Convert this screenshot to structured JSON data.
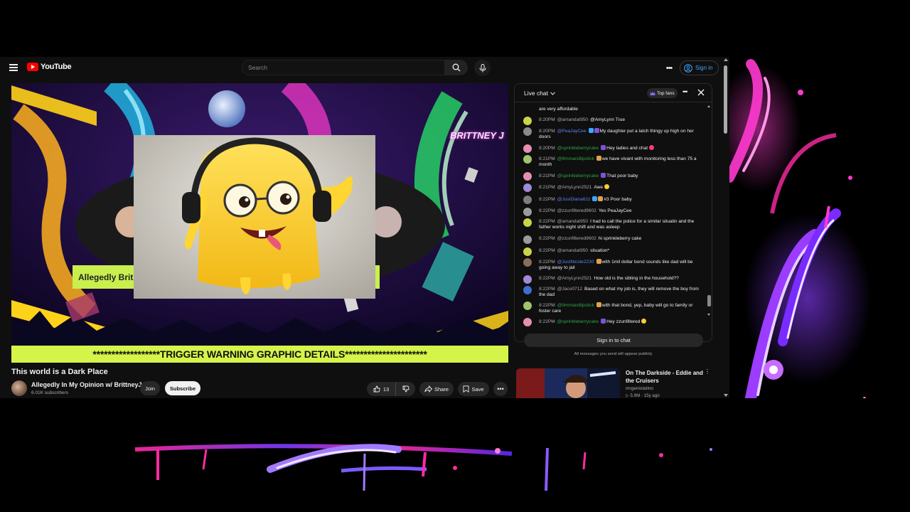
{
  "masthead": {
    "logo_text": "YouTube",
    "search_placeholder": "Search",
    "signin_label": "Sign in"
  },
  "player": {
    "warning_text": "******************TRIGGER WARNING GRAPHIC DETAILS**********************",
    "brand_tag": "BRITTNEY J",
    "banner_text": "Allegedly Brit"
  },
  "video": {
    "title": "This world is a Dark Place",
    "channel_name": "Allegedly In My Opinion w/ BrittneyJ",
    "subscribers": "6.01K subscribers",
    "join_label": "Join",
    "subscribe_label": "Subscribe",
    "like_count": "13",
    "share_label": "Share",
    "save_label": "Save"
  },
  "chat": {
    "title": "Live chat",
    "top_fans_label": "Top fans",
    "messages": [
      {
        "time": "",
        "author": "",
        "text": "are very affordable",
        "avatar_color": "#6b6b6b",
        "author_type": "normal"
      },
      {
        "time": "8:20PM",
        "author": "@amandat950",
        "text": "@AmyLynn True",
        "avatar_color": "#c9d44a",
        "author_type": "normal"
      },
      {
        "time": "8:20PM",
        "author": "@PeaJayCee",
        "text": "My daughter put a latch thingy up high on her doors",
        "avatar_color": "#8a8a8a",
        "author_type": "mod"
      },
      {
        "time": "8:20PM",
        "author": "@sprinkleberrycake",
        "text": "Hey ladies and chat",
        "avatar_color": "#e58fb0",
        "author_type": "member"
      },
      {
        "time": "8:21PM",
        "author": "@9mmandlipstick",
        "text": "we have vivant with monitoring less than 75 a month",
        "avatar_color": "#a0c46a",
        "author_type": "member"
      },
      {
        "time": "8:21PM",
        "author": "@sprinkleberrycake",
        "text": "That poor baby",
        "avatar_color": "#e58fb0",
        "author_type": "member"
      },
      {
        "time": "8:21PM",
        "author": "@AmyLynn2521",
        "text": "Awe",
        "avatar_color": "#9e8ad6",
        "author_type": "normal"
      },
      {
        "time": "8:22PM",
        "author": "@JustDiana62z",
        "text": "#3 Poor baby",
        "avatar_color": "#7d7d7d",
        "author_type": "mod"
      },
      {
        "time": "8:22PM",
        "author": "@zzunfiltered9602",
        "text": "Yes PeaJayCee",
        "avatar_color": "#9b9b9b",
        "author_type": "normal"
      },
      {
        "time": "8:22PM",
        "author": "@amandat950",
        "text": "I had to call the police for a similar situatin and the father works night shift and was asleep",
        "avatar_color": "#c9d44a",
        "author_type": "normal"
      },
      {
        "time": "8:22PM",
        "author": "@zzunfiltered9602",
        "text": "hi sprinkleberry cake",
        "avatar_color": "#9b9b9b",
        "author_type": "normal"
      },
      {
        "time": "8:22PM",
        "author": "@amandat950",
        "text": "situation*",
        "avatar_color": "#c9d44a",
        "author_type": "normal"
      },
      {
        "time": "8:22PM",
        "author": "@JustNicole2230",
        "text": "with 1mil dollar bond sounds like dad will be going away to jail",
        "avatar_color": "#8c6d5a",
        "author_type": "mod"
      },
      {
        "time": "8:22PM",
        "author": "@AmyLynn2521",
        "text": "How old is the sibling in the household??",
        "avatar_color": "#9e8ad6",
        "author_type": "normal"
      },
      {
        "time": "8:22PM",
        "author": "@Jaco0712",
        "text": "Based on what my job is, they will remove the boy from the dad",
        "avatar_color": "#3b6fd1",
        "author_type": "normal"
      },
      {
        "time": "8:22PM",
        "author": "@9mmandlipstick",
        "text": "with that bond, yep, baby will go to family or foster care",
        "avatar_color": "#a0c46a",
        "author_type": "member"
      },
      {
        "time": "8:22PM",
        "author": "@sprinkleberrycake",
        "text": "Hey zzunfiltered",
        "avatar_color": "#e58fb0",
        "author_type": "member"
      }
    ],
    "signin_label": "Sign in to chat",
    "public_note": "All messages you send will appear publicly"
  },
  "related": {
    "title": "On The Darkside - Eddie and the Cruisers",
    "channel": "mrgeniolatino",
    "meta": "▷ 5.9M · 15y ago"
  },
  "colors": {
    "youtube_red": "#ff0000",
    "link_blue": "#3ea6ff",
    "warning_green": "#d4f44a",
    "member_green": "#2ba640"
  }
}
